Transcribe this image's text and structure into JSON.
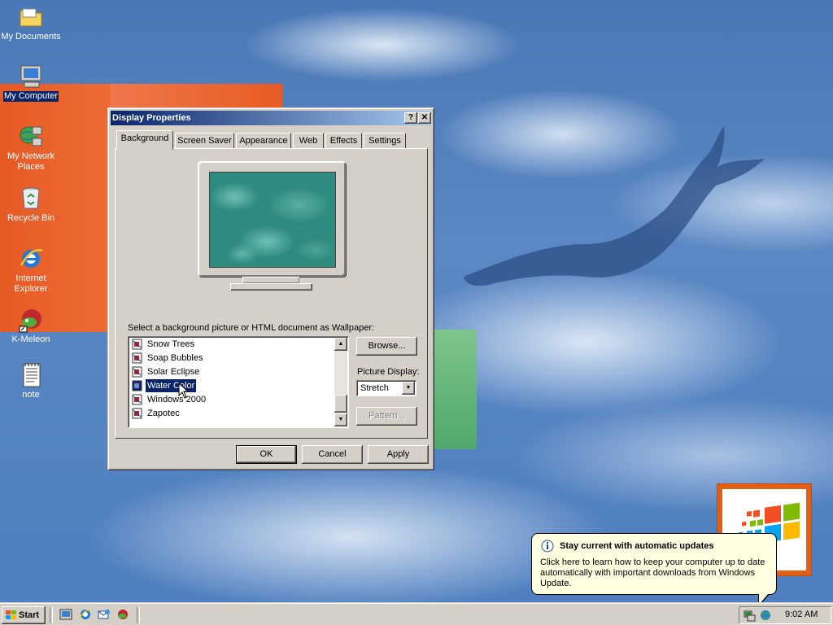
{
  "desktop": {
    "icons": [
      {
        "label": "My Documents"
      },
      {
        "label": "My Computer"
      },
      {
        "label": "My Network Places"
      },
      {
        "label": "Recycle Bin"
      },
      {
        "label": "Internet Explorer"
      },
      {
        "label": "K-Meleon"
      },
      {
        "label": "note"
      }
    ]
  },
  "dialog": {
    "title": "Display Properties",
    "help_button": "?",
    "close_button": "✕",
    "tabs": [
      {
        "label": "Background",
        "active": true
      },
      {
        "label": "Screen Saver"
      },
      {
        "label": "Appearance"
      },
      {
        "label": "Web"
      },
      {
        "label": "Effects"
      },
      {
        "label": "Settings"
      }
    ],
    "wallpaper_prompt": "Select a background picture or HTML document as Wallpaper:",
    "wallpapers": [
      {
        "name": "Snow Trees"
      },
      {
        "name": "Soap Bubbles"
      },
      {
        "name": "Solar Eclipse"
      },
      {
        "name": "Water Color",
        "selected": true
      },
      {
        "name": "Windows 2000"
      },
      {
        "name": "Zapotec"
      }
    ],
    "browse_button": "Browse...",
    "picture_display_label": "Picture Display:",
    "picture_display_value": "Stretch",
    "pattern_button": "Pattern...",
    "ok_button": "OK",
    "cancel_button": "Cancel",
    "apply_button": "Apply"
  },
  "balloon": {
    "title": "Stay current with automatic updates",
    "body": "Click here to learn how to keep your computer up to date automatically with important downloads from Windows Update."
  },
  "taskbar": {
    "start_label": "Start",
    "clock": "9:02 AM"
  },
  "colors": {
    "title_active": "#0a246a",
    "title_gradient_end": "#a6caf0",
    "face": "#d4d0c8",
    "selection": "#0a246a",
    "balloon_bg": "#ffffe1"
  }
}
